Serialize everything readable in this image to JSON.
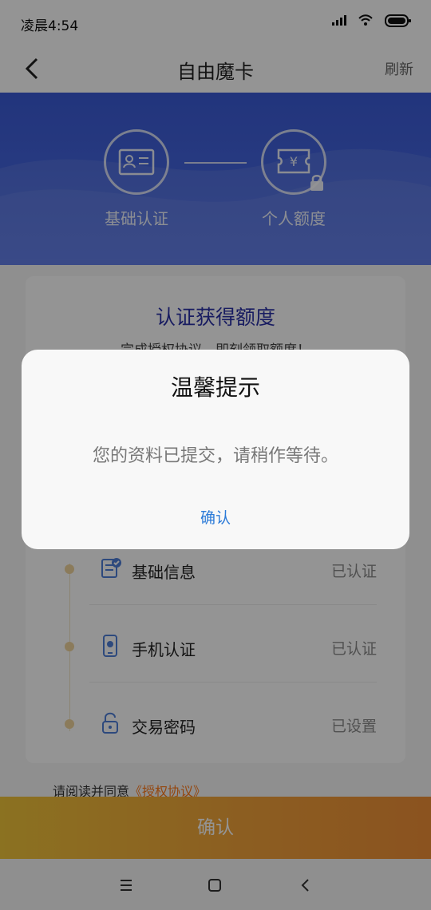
{
  "status_bar": {
    "time": "凌晨4:54"
  },
  "nav": {
    "title": "自由魔卡",
    "refresh": "刷新"
  },
  "steps": [
    {
      "label": "基础认证"
    },
    {
      "label": "个人额度"
    }
  ],
  "card": {
    "title": "认证获得额度",
    "subtitle": "完成授权协议，即刻领取额度！",
    "items": [
      {
        "label": "基础信息",
        "status": "已认证"
      },
      {
        "label": "手机认证",
        "status": "已认证"
      },
      {
        "label": "交易密码",
        "status": "已设置"
      }
    ]
  },
  "agreement": {
    "prefix": "请阅读并同意",
    "link": "《授权协议》"
  },
  "footer": {
    "confirm": "确认"
  },
  "dialog": {
    "title": "温馨提示",
    "message": "您的资料已提交，请稍作等待。",
    "confirm": "确认"
  },
  "colors": {
    "accent_blue": "#3b5bd6",
    "title_blue": "#2a31a8",
    "confirm_blue": "#2c7bd8",
    "link_orange": "#ff7a1a",
    "footer_gold": "#f0c43a"
  }
}
